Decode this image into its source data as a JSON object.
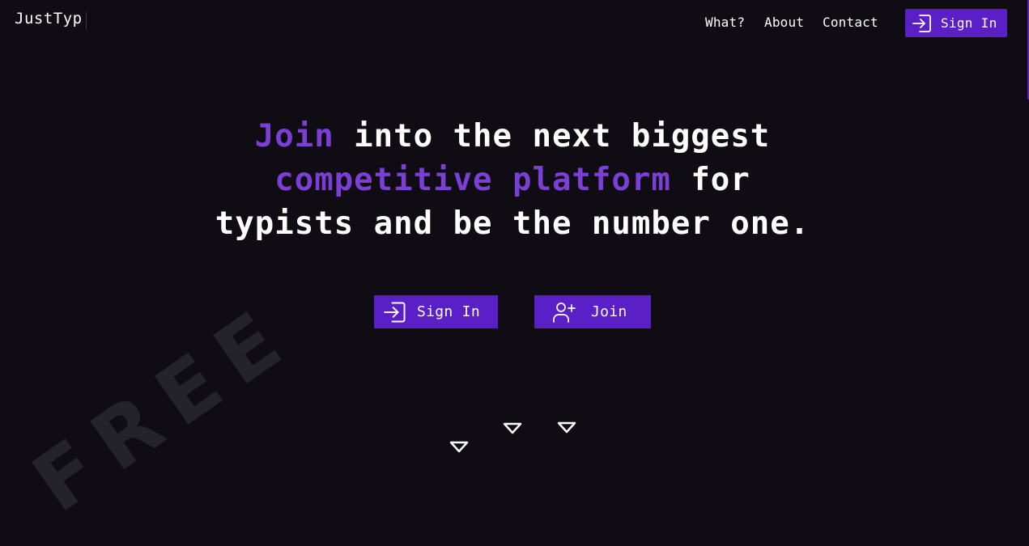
{
  "header": {
    "logo": "JustTyp",
    "nav": [
      {
        "label": "What?"
      },
      {
        "label": "About"
      },
      {
        "label": "Contact"
      }
    ],
    "signin_label": "Sign In"
  },
  "hero": {
    "line1_accent": "Join",
    "line1_rest": " into the next biggest",
    "line2_accent": "competitive platform",
    "line2_rest": " for",
    "line3": "typists and be the number one.",
    "signin_label": "Sign In",
    "join_label": "Join"
  },
  "background": {
    "watermark": "FREE"
  },
  "colors": {
    "background": "#0f0d13",
    "accent_text": "#7c3fd6",
    "button": "#5a1fc7"
  },
  "icons": {
    "signin": "sign-in-icon",
    "join": "user-plus-icon",
    "decor": "triangle-down-icon"
  }
}
